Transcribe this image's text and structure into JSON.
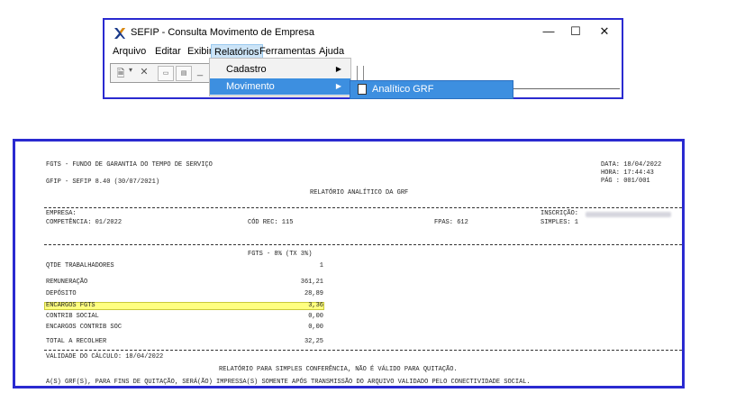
{
  "window": {
    "title": "SEFIP - Consulta Movimento de Empresa",
    "minimize": "—",
    "maximize": "☐",
    "close": "✕"
  },
  "menubar": [
    "Arquivo",
    "Editar",
    "Exibir",
    "Relatórios",
    "Ferramentas",
    "Ajuda"
  ],
  "dropdown": [
    {
      "label": "Cadastro",
      "has_submenu": true
    },
    {
      "label": "Movimento",
      "has_submenu": true,
      "selected": true
    }
  ],
  "submenu": {
    "label": "Analítico GRF"
  },
  "report": {
    "h1": "FGTS - FUNDO DE GARANTIA DO TEMPO DE SERVIÇO",
    "h2": "GFIP - SEFIP 8.40 (30/07/2021)",
    "title": "RELATÓRIO ANALÍTICO DA GRF",
    "data": "DATA: 18/04/2022",
    "hora": "HORA:  17:44:43",
    "pag": "PÁG :   001/001",
    "empresa": "EMPRESA:",
    "inscricao": "INSCRIÇÃO:",
    "competencia": "COMPETÊNCIA: 01/2022",
    "cod_rec": "CÓD REC: 115",
    "fpas": "FPAS: 612",
    "simples": "SIMPLES:  1",
    "fgts_header": "FGTS - 8% (TX 3%)",
    "rows": [
      {
        "label": "QTDE TRABALHADORES",
        "value": "1"
      },
      {
        "label": "REMUNERAÇÃO",
        "value": "361,21"
      },
      {
        "label": "DEPÓSITO",
        "value": "28,89"
      },
      {
        "label": "ENCARGOS FGTS",
        "value": "3,36"
      },
      {
        "label": "CONTRIB SOCIAL",
        "value": "0,00"
      },
      {
        "label": "ENCARGOS CONTRIB SOC",
        "value": "0,00"
      },
      {
        "label": "TOTAL A RECOLHER",
        "value": "32,25"
      }
    ],
    "validade": "VALIDADE DO CÁLCULO: 18/04/2022",
    "note1": "RELATÓRIO PARA SIMPLES CONFERÊNCIA, NÃO É VÁLIDO PARA QUITAÇÃO.",
    "note2": "A(S) GRF(S), PARA FINS DE QUITAÇÃO, SERÁ(ÃO) IMPRESSA(S) SOMENTE APÓS TRANSMISSÃO DO ARQUIVO VALIDADO PELO CONECTIVIDADE SOCIAL."
  }
}
